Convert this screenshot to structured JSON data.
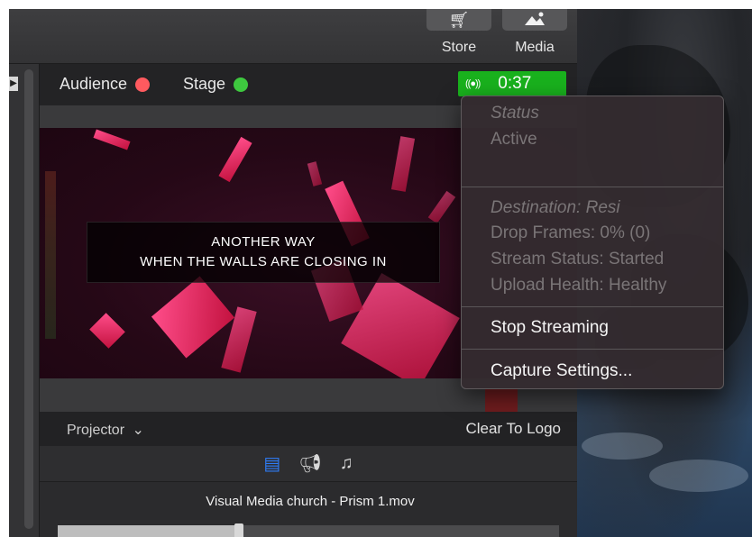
{
  "toolbar": {
    "store_label": "Store",
    "media_label": "Media",
    "store_icon": "cart-icon",
    "media_icon": "image-icon"
  },
  "status": {
    "audience_label": "Audience",
    "audience_color": "#ff5a5f",
    "stage_label": "Stage",
    "stage_color": "#3ec83f",
    "stream_icon": "broadcast-icon",
    "stream_time": "0:37",
    "stream_color": "#19b11d"
  },
  "preview": {
    "lyric_line1": "ANOTHER WAY",
    "lyric_line2": "WHEN THE WALLS ARE CLOSING IN"
  },
  "projector": {
    "label": "Projector",
    "clear_label": "Clear To Logo"
  },
  "bottom_icons": [
    "slides-icon",
    "announcement-icon",
    "music-icon"
  ],
  "media": {
    "filename": "Visual Media church - Prism 1.mov",
    "progress": 0.36
  },
  "menu": {
    "status_header": "Status",
    "status_value": "Active",
    "destination": "Destination: Resi",
    "drop_frames": "Drop Frames: 0% (0)",
    "stream_status": "Stream Status: Started",
    "upload_health": "Upload Health: Healthy",
    "stop_streaming": "Stop Streaming",
    "capture_settings": "Capture Settings..."
  }
}
